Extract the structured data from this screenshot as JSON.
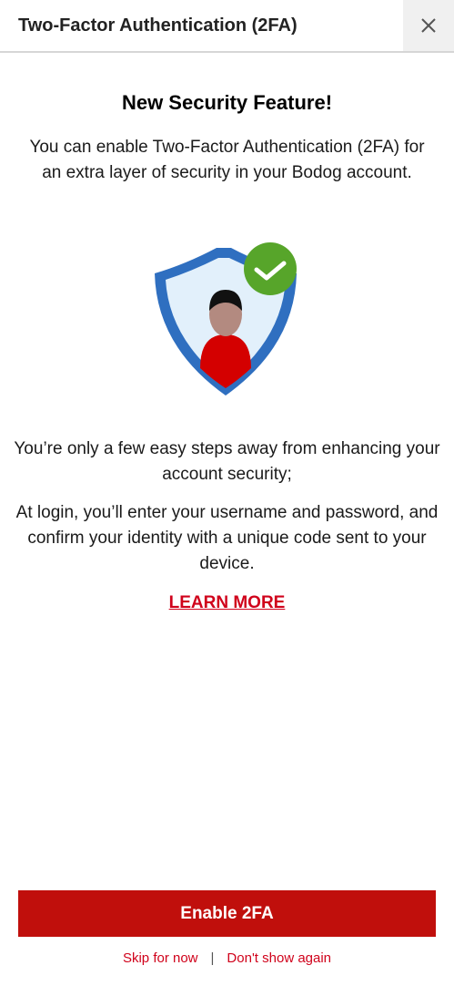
{
  "header": {
    "title": "Two-Factor Authentication (2FA)",
    "close_icon": "close-icon"
  },
  "main": {
    "feature_title": "New Security Feature!",
    "intro": "You can enable Two-Factor Authentication (2FA) for an extra layer of security in your Bodog account.",
    "illustration_icon": "shield-user-check-icon",
    "steps_text": "You’re only a few easy steps away from enhancing your account security;",
    "login_text": "At login, you’ll enter your username and password, and confirm your identity with a unique code sent to your device.",
    "learn_more_label": "LEARN MORE"
  },
  "footer": {
    "enable_label": "Enable 2FA",
    "skip_label": "Skip for now",
    "separator": "|",
    "dont_show_label": "Don't show again"
  },
  "colors": {
    "accent_red": "#c00f0c",
    "link_red": "#d0021b",
    "shield_blue": "#2f6fc0",
    "check_green": "#57a52a"
  }
}
